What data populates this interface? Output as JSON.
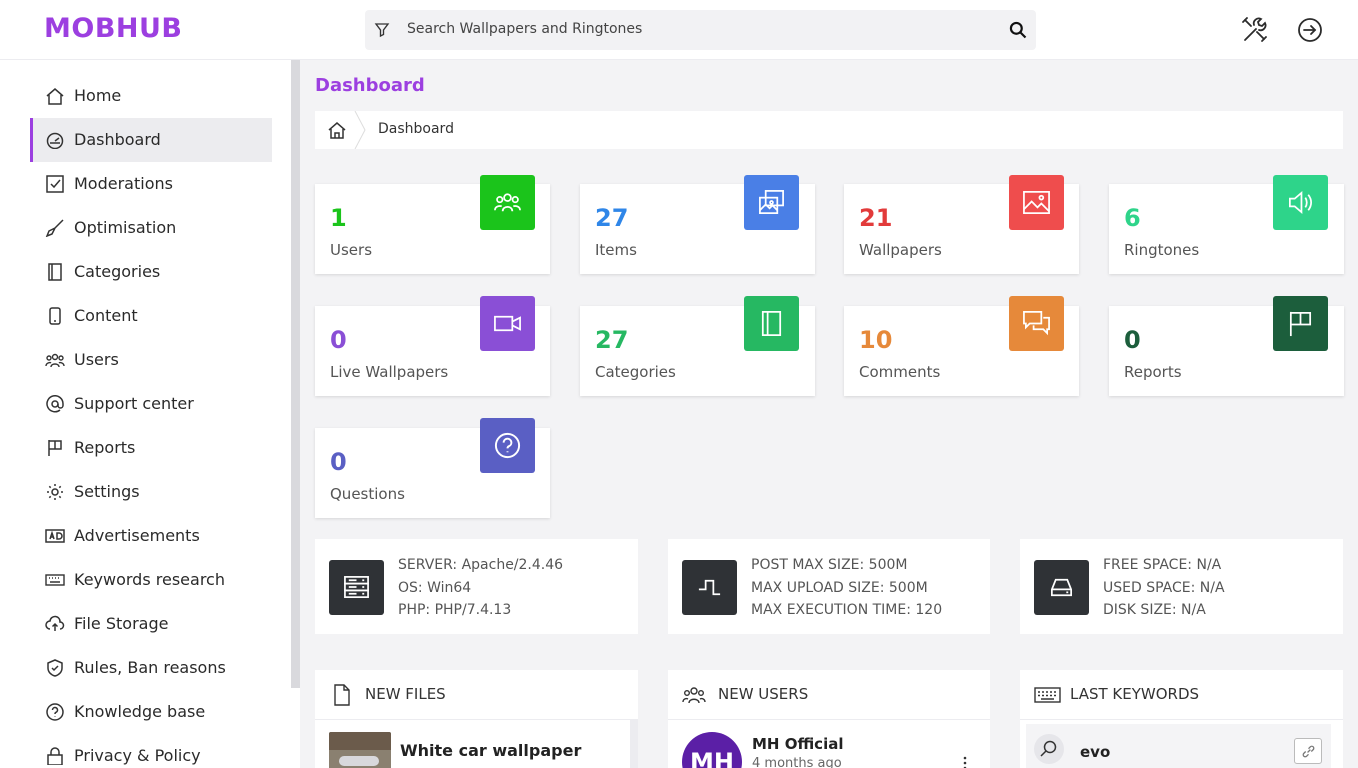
{
  "app": {
    "logo": "MOBHUB"
  },
  "search": {
    "placeholder": "Search Wallpapers and Ringtones"
  },
  "sidebar": {
    "items": [
      {
        "label": "Home"
      },
      {
        "label": "Dashboard"
      },
      {
        "label": "Moderations"
      },
      {
        "label": "Optimisation"
      },
      {
        "label": "Categories"
      },
      {
        "label": "Content"
      },
      {
        "label": "Users"
      },
      {
        "label": "Support center"
      },
      {
        "label": "Reports"
      },
      {
        "label": "Settings"
      },
      {
        "label": "Advertisements"
      },
      {
        "label": "Keywords research"
      },
      {
        "label": "File Storage"
      },
      {
        "label": "Rules, Ban reasons"
      },
      {
        "label": "Knowledge base"
      },
      {
        "label": "Privacy & Policy"
      }
    ]
  },
  "main": {
    "title": "Dashboard",
    "breadcrumb": "Dashboard"
  },
  "stats": [
    {
      "value": "1",
      "label": "Users",
      "color": "#1bc41b"
    },
    {
      "value": "27",
      "label": "Items",
      "color": "#4a7fe6"
    },
    {
      "value": "21",
      "label": "Wallpapers",
      "color": "#ef4d4d"
    },
    {
      "value": "6",
      "label": "Ringtones",
      "color": "#2ed48a"
    },
    {
      "value": "0",
      "label": "Live Wallpapers",
      "color": "#8a4fd6"
    },
    {
      "value": "27",
      "label": "Categories",
      "color": "#26b862"
    },
    {
      "value": "10",
      "label": "Comments",
      "color": "#e6893a"
    },
    {
      "value": "0",
      "label": "Reports",
      "color": "#1c5e3c"
    },
    {
      "value": "0",
      "label": "Questions",
      "color": "#5a5fc4"
    }
  ],
  "server": {
    "server": "SERVER: Apache/2.4.46",
    "os": "OS: Win64",
    "php": "PHP: PHP/7.4.13"
  },
  "limits": {
    "post": "POST MAX SIZE: 500M",
    "upload": "MAX UPLOAD SIZE: 500M",
    "exec": "MAX EXECUTION TIME: 120"
  },
  "disk": {
    "free": "FREE SPACE: N/A",
    "used": "USED SPACE: N/A",
    "size": "DISK SIZE: N/A"
  },
  "panels": {
    "new_files": {
      "title": "NEW FILES",
      "item_title": "White car wallpaper"
    },
    "new_users": {
      "title": "NEW USERS",
      "item_name": "MH Official",
      "item_time": "4 months ago",
      "avatar_initials": "MH"
    },
    "last_keywords": {
      "title": "LAST KEYWORDS",
      "item": "evo"
    }
  }
}
